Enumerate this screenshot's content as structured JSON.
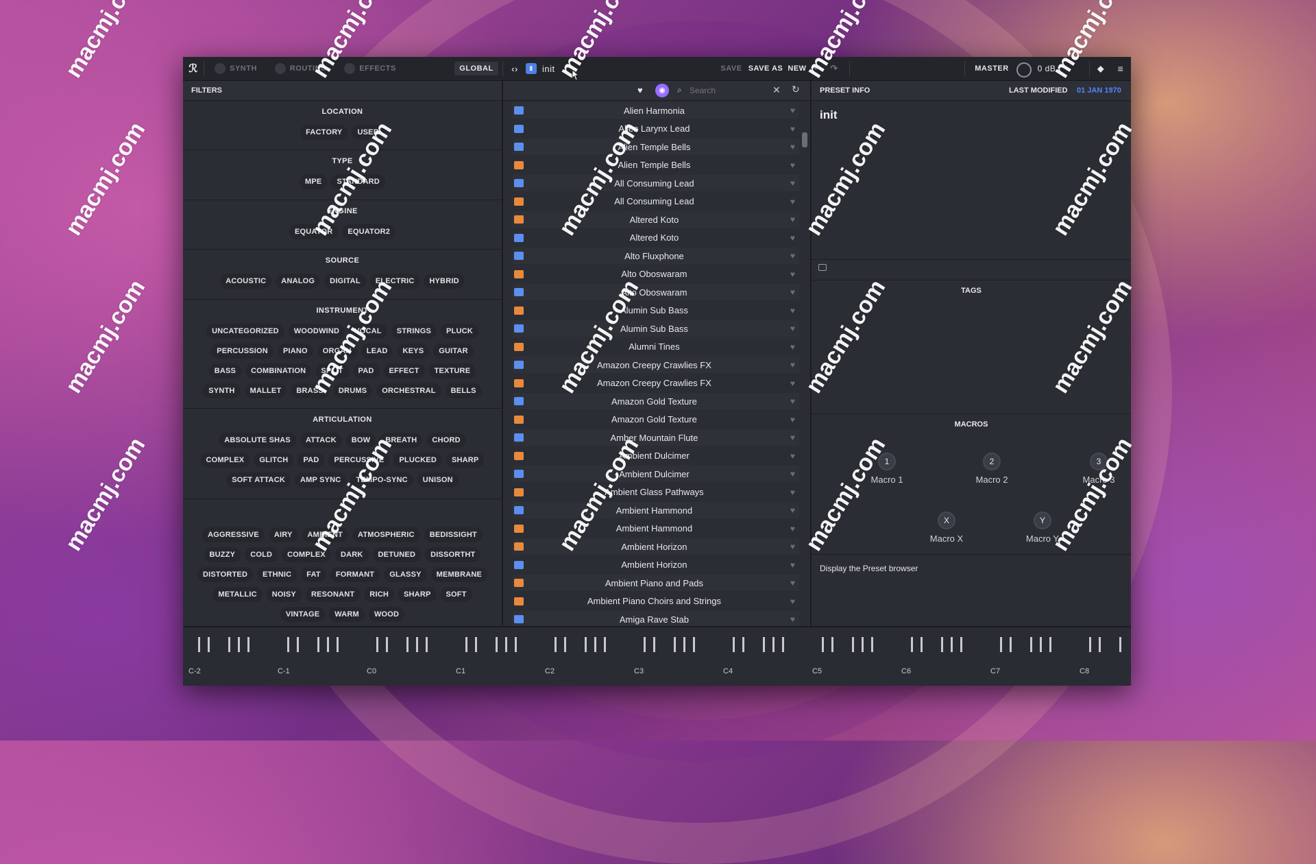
{
  "toolbar": {
    "tabs": [
      "SYNTH",
      "ROUTING",
      "EFFECTS",
      "GLOBAL"
    ],
    "preset_name": "init",
    "save_label": "SAVE",
    "save_as_label": "SAVE AS",
    "new_label": "NEW",
    "master_label": "MASTER",
    "master_value": "0 dB"
  },
  "filters": {
    "header": "FILTERS",
    "location": {
      "title": "LOCATION",
      "chips": [
        "FACTORY",
        "USER"
      ]
    },
    "type": {
      "title": "TYPE",
      "chips": [
        "MPE",
        "STANDARD"
      ]
    },
    "engine": {
      "title": "ENGINE",
      "chips": [
        "EQUATOR",
        "EQUATOR2"
      ]
    },
    "source": {
      "title": "SOURCE",
      "chips": [
        "ACOUSTIC",
        "ANALOG",
        "DIGITAL",
        "ELECTRIC",
        "HYBRID"
      ]
    },
    "instrument": {
      "title": "INSTRUMENT",
      "chips": [
        "UNCATEGORIZED",
        "WOODWIND",
        "VOCAL",
        "STRINGS",
        "PLUCK",
        "PERCUSSION",
        "PIANO",
        "ORGAN",
        "LEAD",
        "KEYS",
        "GUITAR",
        "BASS",
        "COMBINATION",
        "SPLIT",
        "PAD",
        "EFFECT",
        "TEXTURE",
        "SYNTH",
        "MALLET",
        "BRASS",
        "DRUMS",
        "ORCHESTRAL",
        "BELLS"
      ]
    },
    "articulation": {
      "title": "ARTICULATION",
      "chips": [
        "ABSOLUTE SHAS",
        "ATTACK",
        "BOW",
        "BREATH",
        "CHORD",
        "COMPLEX",
        "GLITCH",
        "PAD",
        "PERCUSSIVE",
        "PLUCKED",
        "SHARP",
        "SOFT ATTACK",
        "AMP SYNC",
        "TEMPO-SYNC",
        "UNISON"
      ]
    },
    "character": {
      "title": "",
      "chips": [
        "AGGRESSIVE",
        "AIRY",
        "AMBIENT",
        "ATMOSPHERIC",
        "BEDISSIGHT",
        "BUZZY",
        "COLD",
        "COMPLEX",
        "DARK",
        "DETUNED",
        "DISSORTHT",
        "DISTORTED",
        "ETHNIC",
        "FAT",
        "FORMANT",
        "GLASSY",
        "MEMBRANE",
        "METALLIC",
        "NOISY",
        "RESONANT",
        "RICH",
        "SHARP",
        "SOFT",
        "VINTAGE",
        "WARM",
        "WOOD"
      ]
    }
  },
  "browser": {
    "search_placeholder": "Search",
    "presets": [
      {
        "name": "Alien Harmonia",
        "kind": "blue"
      },
      {
        "name": "Alien Larynx Lead",
        "kind": "blue"
      },
      {
        "name": "Alien Temple Bells",
        "kind": "blue"
      },
      {
        "name": "Alien Temple Bells",
        "kind": "orange"
      },
      {
        "name": "All Consuming Lead",
        "kind": "blue"
      },
      {
        "name": "All Consuming Lead",
        "kind": "orange"
      },
      {
        "name": "Altered Koto",
        "kind": "orange"
      },
      {
        "name": "Altered Koto",
        "kind": "blue"
      },
      {
        "name": "Alto Fluxphone",
        "kind": "blue"
      },
      {
        "name": "Alto Oboswaram",
        "kind": "orange"
      },
      {
        "name": "Alto Oboswaram",
        "kind": "blue"
      },
      {
        "name": "Alumin Sub Bass",
        "kind": "orange"
      },
      {
        "name": "Alumin Sub Bass",
        "kind": "blue"
      },
      {
        "name": "Alumni Tines",
        "kind": "orange"
      },
      {
        "name": "Amazon Creepy Crawlies FX",
        "kind": "blue"
      },
      {
        "name": "Amazon Creepy Crawlies FX",
        "kind": "orange"
      },
      {
        "name": "Amazon Gold Texture",
        "kind": "blue"
      },
      {
        "name": "Amazon Gold Texture",
        "kind": "orange"
      },
      {
        "name": "Amber Mountain Flute",
        "kind": "blue"
      },
      {
        "name": "Ambient Dulcimer",
        "kind": "orange"
      },
      {
        "name": "Ambient Dulcimer",
        "kind": "blue"
      },
      {
        "name": "Ambient Glass Pathways",
        "kind": "orange"
      },
      {
        "name": "Ambient Hammond",
        "kind": "blue"
      },
      {
        "name": "Ambient Hammond",
        "kind": "orange"
      },
      {
        "name": "Ambient Horizon",
        "kind": "orange"
      },
      {
        "name": "Ambient Horizon",
        "kind": "blue"
      },
      {
        "name": "Ambient Piano and Pads",
        "kind": "orange"
      },
      {
        "name": "Ambient Piano Choirs and Strings",
        "kind": "orange"
      },
      {
        "name": "Amiga Rave Stab",
        "kind": "blue"
      }
    ]
  },
  "preset_info": {
    "header": "PRESET INFO",
    "last_modified_label": "LAST MODIFIED",
    "last_modified_value": "01 JAN 1970",
    "name": "init",
    "tags_label": "TAGS",
    "macros_label": "MACROS",
    "macros": [
      {
        "knob": "1",
        "label": "Macro 1"
      },
      {
        "knob": "2",
        "label": "Macro 2"
      },
      {
        "knob": "3",
        "label": "Macro 3"
      },
      {
        "knob": "X",
        "label": "Macro X"
      },
      {
        "knob": "Y",
        "label": "Macro Y"
      }
    ],
    "hint": "Display the Preset browser"
  },
  "keyboard": {
    "octaves": [
      "C-2",
      "C-1",
      "C0",
      "C1",
      "C2",
      "C3",
      "C4",
      "C5",
      "C6",
      "C7",
      "C8"
    ]
  },
  "watermark": "macmj.com",
  "colors": {
    "accent_blue": "#5b8ff0",
    "accent_orange": "#e88a3c",
    "accent_purple": "#9a6cff",
    "date_blue": "#4f86ff"
  }
}
